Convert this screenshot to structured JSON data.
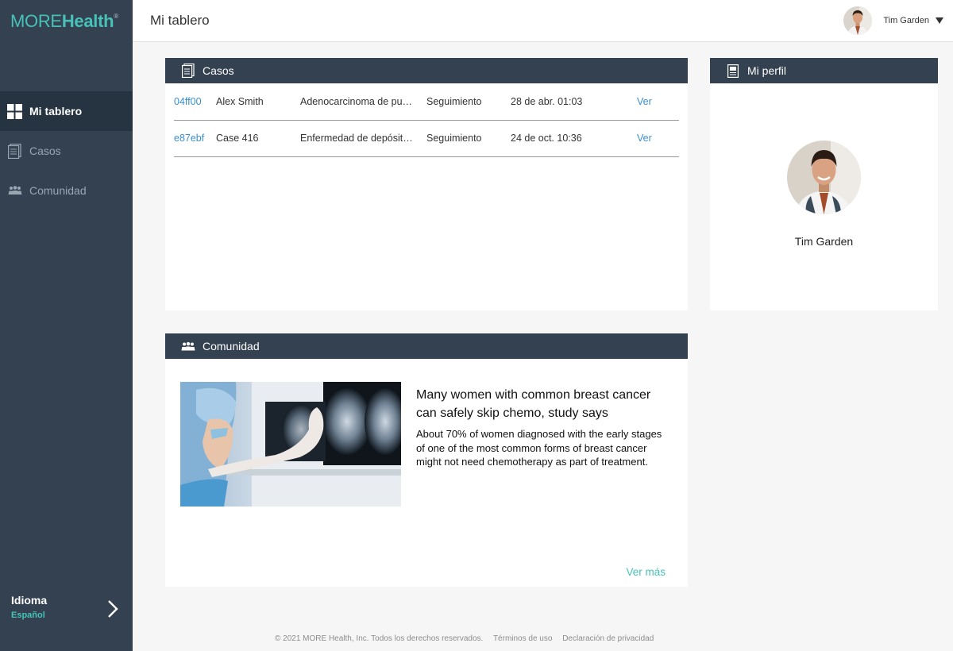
{
  "brand": {
    "word1": "MORE",
    "word2": "Health",
    "mark": "®"
  },
  "nav": {
    "items": [
      {
        "label": "Mi tablero",
        "icon": "dashboard-grid-icon"
      },
      {
        "label": "Casos",
        "icon": "document-icon"
      },
      {
        "label": "Comunidad",
        "icon": "people-icon"
      }
    ]
  },
  "language": {
    "title": "Idioma",
    "value": "Español"
  },
  "header": {
    "title": "Mi tablero",
    "user_name": "Tim Garden"
  },
  "cases": {
    "title": "Casos",
    "rows": [
      {
        "id": "04ff00",
        "name": "Alex Smith",
        "diagnosis": "Adenocarcinoma de pu…",
        "status": "Seguimiento",
        "date": "28 de abr. 01:03",
        "action": "Ver"
      },
      {
        "id": "e87ebf",
        "name": "Case 416",
        "diagnosis": "Enfermedad de depósit…",
        "status": "Seguimiento",
        "date": "24 de oct. 10:36",
        "action": "Ver"
      }
    ]
  },
  "profile": {
    "title": "Mi perfil",
    "name": "Tim Garden"
  },
  "community": {
    "title": "Comunidad",
    "article": {
      "title": "Many women with common breast cancer can safely skip chemo, study says",
      "body": "About 70% of women diagnosed with the early stages of one of the most common forms of breast cancer might not need chemotherapy as part of treatment."
    },
    "more_label": "Ver más"
  },
  "footer": {
    "copyright": "© 2021 MORE Health, Inc. Todos los derechos reservados.",
    "terms": "Términos de uso",
    "privacy": "Declaración de privacidad"
  },
  "colors": {
    "sidebar": "#334150",
    "accent": "#48c2b9",
    "link": "#3a8fd0"
  }
}
